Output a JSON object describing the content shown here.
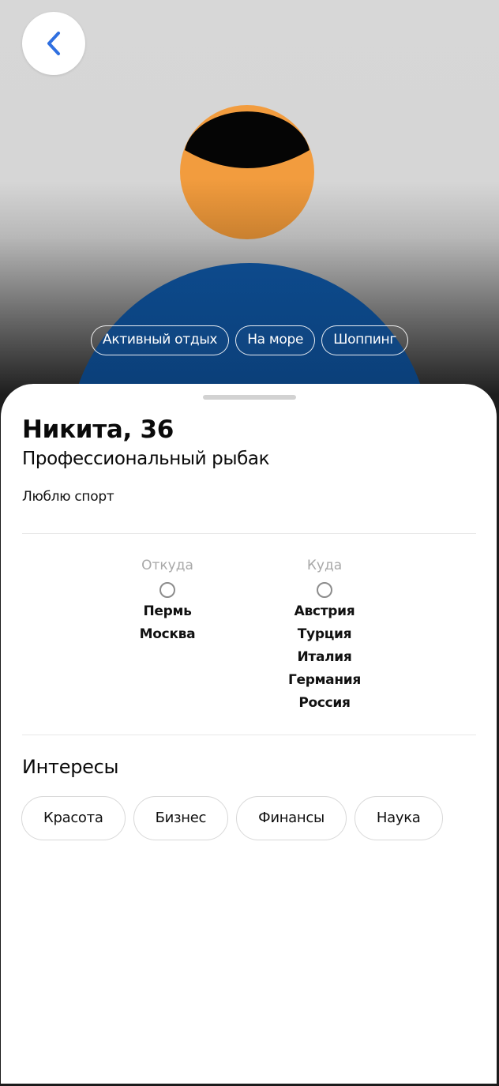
{
  "header": {
    "back_icon": "chevron-left-icon",
    "accent_color": "#2f6fe0"
  },
  "photo": {
    "tags": [
      "Активный отдых",
      "На море",
      "Шоппинг"
    ]
  },
  "profile": {
    "name_age": "Никита, 36",
    "profession": "Профессиональный рыбак",
    "about": "Люблю спорт"
  },
  "route": {
    "from_label": "Откуда",
    "from": [
      "Пермь",
      "Москва"
    ],
    "to_label": "Куда",
    "to": [
      "Австрия",
      "Турция",
      "Италия",
      "Германия",
      "Россия"
    ]
  },
  "interests": {
    "title": "Интересы",
    "items": [
      "Красота",
      "Бизнес",
      "Финансы",
      "Наука"
    ]
  }
}
